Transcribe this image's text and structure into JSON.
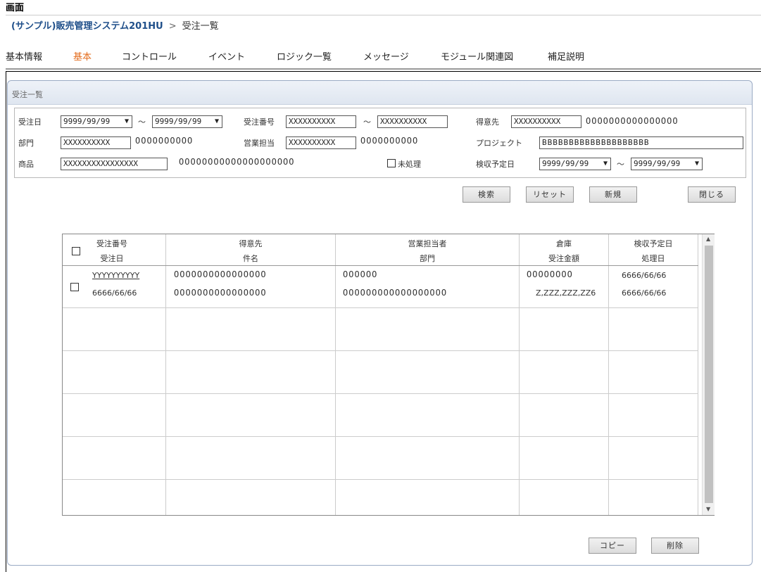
{
  "page": {
    "title": "画面"
  },
  "breadcrumb": {
    "system": "(サンプル)販売管理システム201HU",
    "separator": ">",
    "current": "受注一覧"
  },
  "tabs": [
    {
      "label": "基本情報",
      "active": false
    },
    {
      "label": "基本",
      "active": true
    },
    {
      "label": "コントロール",
      "active": false
    },
    {
      "label": "イベント",
      "active": false
    },
    {
      "label": "ロジック一覧",
      "active": false
    },
    {
      "label": "メッセージ",
      "active": false
    },
    {
      "label": "モジュール関連図",
      "active": false
    },
    {
      "label": "補足説明",
      "active": false
    }
  ],
  "panel": {
    "title": "受注一覧"
  },
  "search": {
    "order_date_label": "受注日",
    "order_date_from": "9999/99/99",
    "order_date_to": "9999/99/99",
    "tilde": "～",
    "order_no_label": "受注番号",
    "order_no_from": "XXXXXXXXXX",
    "order_no_to": "XXXXXXXXXX",
    "customer_label": "得意先",
    "customer_code": "XXXXXXXXXX",
    "customer_name": "OOOOOOOOOOOOOOOO",
    "dept_label": "部門",
    "dept_code": "XXXXXXXXXX",
    "dept_name": "OOOOOOOOOO",
    "sales_label": "営業担当",
    "sales_code": "XXXXXXXXXX",
    "sales_name": "OOOOOOOOOO",
    "project_label": "プロジェクト",
    "project_value": "BBBBBBBBBBBBBBBBBBBB",
    "product_label": "商品",
    "product_code": "XXXXXXXXXXXXXXXX",
    "product_name": "OOOOOOOOOOOOOOOOOOOO",
    "unprocessed_label": "未処理",
    "acceptance_label": "検収予定日",
    "acceptance_from": "9999/99/99",
    "acceptance_to": "9999/99/99"
  },
  "buttons": {
    "search": "検索",
    "reset": "リセット",
    "new": "新規",
    "close": "閉じる",
    "copy": "コピー",
    "delete": "削除"
  },
  "grid": {
    "headers": {
      "order_no": "受注番号",
      "order_date": "受注日",
      "customer": "得意先",
      "subject": "件名",
      "sales_person": "営業担当者",
      "dept": "部門",
      "warehouse": "倉庫",
      "amount": "受注金額",
      "acceptance_date": "検収予定日",
      "process_date": "処理日"
    },
    "rows": [
      {
        "order_no": "YYYYYYYYYY",
        "order_date": "6666/66/66",
        "customer": "OOOOOOOOOOOOOOOO",
        "subject": "OOOOOOOOOOOOOOOO",
        "sales_person": "OOOOOO",
        "dept": "OOOOOOOOOOOOOOOOOO",
        "warehouse": "OOOOOOOO",
        "amount": "Z,ZZZ,ZZZ,ZZ6",
        "acceptance_date": "6666/66/66",
        "process_date": "6666/66/66"
      }
    ]
  },
  "icons": {
    "dropdown": "▼",
    "scroll_up": "▲",
    "scroll_down": "▼"
  }
}
